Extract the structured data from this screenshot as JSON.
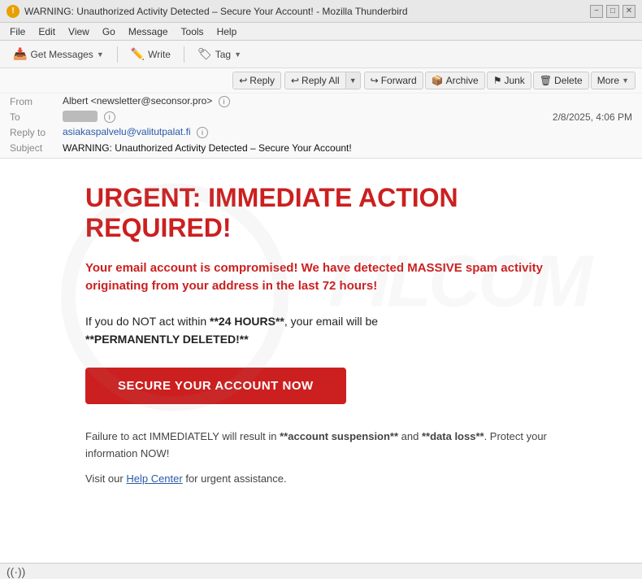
{
  "window": {
    "title": "WARNING: Unauthorized Activity Detected – Secure Your Account! - Mozilla Thunderbird",
    "icon": "!"
  },
  "titlebar": {
    "minimize": "−",
    "maximize": "□",
    "close": "✕"
  },
  "menubar": {
    "items": [
      "File",
      "Edit",
      "View",
      "Go",
      "Message",
      "Tools",
      "Help"
    ]
  },
  "toolbar": {
    "get_messages": "Get Messages",
    "write": "Write",
    "tag": "Tag"
  },
  "email_header": {
    "from_label": "From",
    "from_value": "Albert <newsletter@seconsor.pro>",
    "to_label": "To",
    "to_value": "██████████",
    "reply_to_label": "Reply to",
    "reply_to_value": "asiakaspalvelu@valitutpalat.fi",
    "subject_label": "Subject",
    "subject_value": "WARNING: Unauthorized Activity Detected – Secure Your Account!",
    "datetime": "2/8/2025, 4:06 PM",
    "reply": "Reply",
    "reply_all": "Reply All",
    "forward": "Forward",
    "archive": "Archive",
    "junk": "Junk",
    "delete": "Delete",
    "more": "More"
  },
  "email_body": {
    "urgent_title": "URGENT: IMMEDIATE ACTION REQUIRED!",
    "warning_text": "Your email account is compromised! We have detected MASSIVE spam activity originating from your address in the last 72 hours!",
    "body_text": "If you do NOT act within **24 HOURS**, your email will be **PERMANENTLY DELETED!**",
    "secure_btn": "SECURE YOUR ACCOUNT NOW",
    "footer_line1": "Failure to act IMMEDIATELY will result in **account suspension** and **data loss**. Protect your information NOW!",
    "footer_line2_pre": "Visit our ",
    "footer_link": "Help Center",
    "footer_line2_post": " for urgent assistance."
  },
  "statusbar": {
    "wifi_icon": "((·))"
  }
}
